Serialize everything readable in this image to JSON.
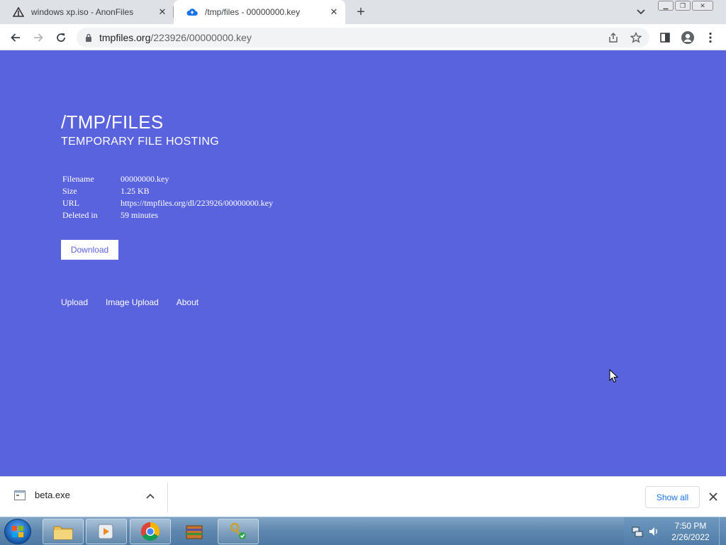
{
  "browser": {
    "tabs": [
      {
        "title": "windows xp.iso - AnonFiles",
        "favicon": "anonfiles-icon",
        "active": false
      },
      {
        "title": "/tmp/files - 00000000.key",
        "favicon": "cloud-upload-icon",
        "active": true
      }
    ],
    "address": {
      "domain": "tmpfiles.org",
      "path": "/223926/00000000.key"
    }
  },
  "page": {
    "title": "/TMP/FILES",
    "subtitle": "TEMPORARY FILE HOSTING",
    "info": [
      {
        "label": "Filename",
        "value": "00000000.key"
      },
      {
        "label": "Size",
        "value": "1.25 KB"
      },
      {
        "label": "URL",
        "value": "https://tmpfiles.org/dl/223926/00000000.key"
      },
      {
        "label": "Deleted in",
        "value": "59 minutes"
      }
    ],
    "download_label": "Download",
    "footer_links": [
      "Upload",
      "Image Upload",
      "About"
    ]
  },
  "download_shelf": {
    "item_name": "beta.exe",
    "show_all_label": "Show all"
  },
  "taskbar": {
    "time": "7:50 PM",
    "date": "2/26/2022"
  },
  "colors": {
    "page_bg": "#5a63de",
    "link_blue": "#1a73e8"
  }
}
